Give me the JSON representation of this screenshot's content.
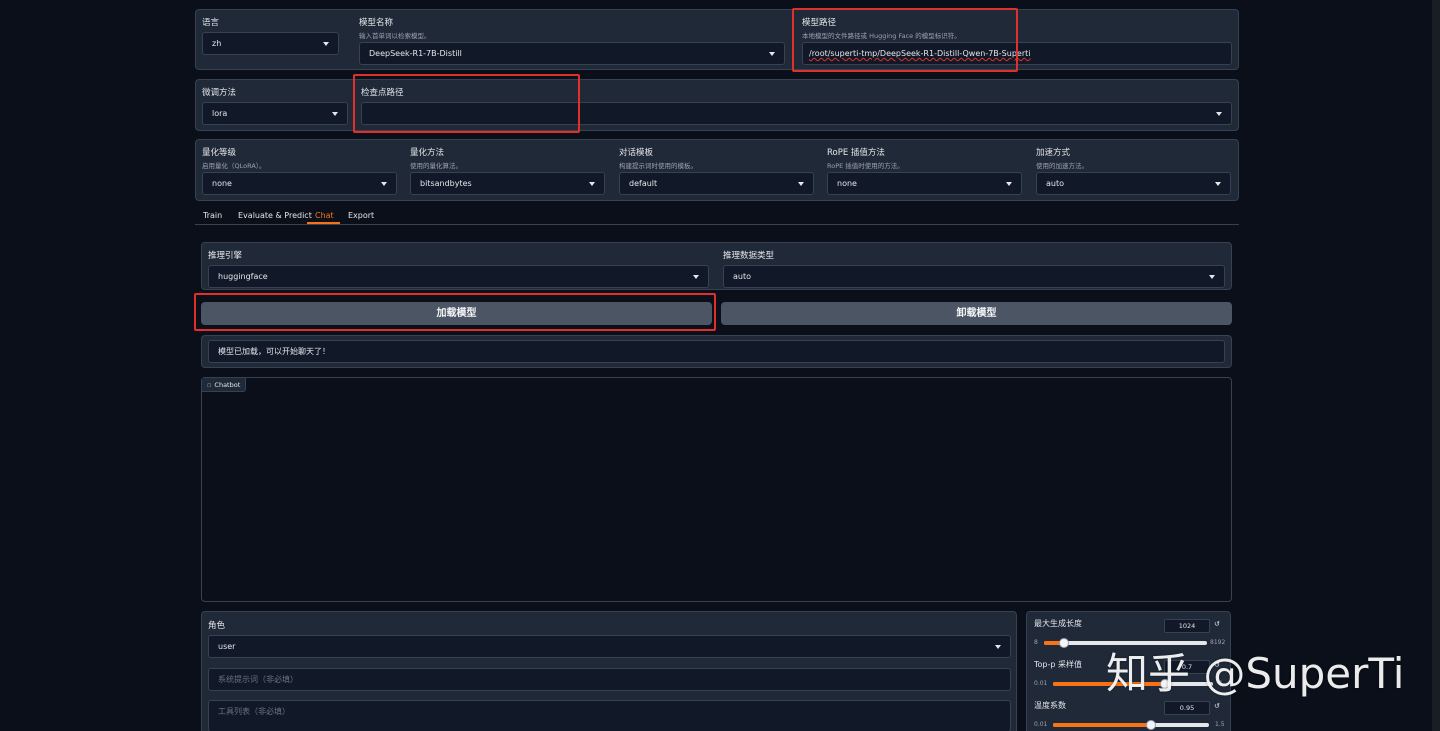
{
  "top": {
    "lang_label": "语言",
    "lang_value": "zh",
    "model_name_label": "模型名称",
    "model_name_info": "输入首单词以检索模型。",
    "model_name_value": "DeepSeek-R1-7B-Distill",
    "model_path_label": "模型路径",
    "model_path_info": "本地模型的文件路径或 Hugging Face 的模型标识符。",
    "model_path_value": "/root/superti-tmp/DeepSeek-R1-Distill-Qwen-7B-Superti"
  },
  "row2": {
    "finetune_label": "微调方法",
    "finetune_value": "lora",
    "checkpoint_label": "检查点路径",
    "checkpoint_value": ""
  },
  "row3": [
    {
      "label": "量化等级",
      "info": "启用量化（QLoRA）。",
      "value": "none"
    },
    {
      "label": "量化方法",
      "info": "使用的量化算法。",
      "value": "bitsandbytes"
    },
    {
      "label": "对话模板",
      "info": "构建提示词时使用的模板。",
      "value": "default"
    },
    {
      "label": "RoPE 插值方法",
      "info": "RoPE 插值时使用的方法。",
      "value": "none"
    },
    {
      "label": "加速方式",
      "info": "使用的加速方法。",
      "value": "auto"
    }
  ],
  "tabs": [
    "Train",
    "Evaluate & Predict",
    "Chat",
    "Export"
  ],
  "active_tab": "Chat",
  "colors": {
    "accent": "#f97316",
    "highlight": "#e0302b",
    "background": "#0b0f19",
    "panel": "#1f2937"
  },
  "chat": {
    "infer_backend_label": "推理引擎",
    "infer_backend_value": "huggingface",
    "infer_dtype_label": "推理数据类型",
    "infer_dtype_value": "auto",
    "load_button": "加载模型",
    "unload_button": "卸载模型",
    "status_text": "模型已加载，可以开始聊天了！",
    "chatbot_label": "Chatbot",
    "role_label": "角色",
    "role_value": "user",
    "system_placeholder": "系统提示词（非必填）",
    "tools_placeholder": "工具列表（非必填）"
  },
  "params": {
    "max_new_tokens": {
      "label": "最大生成长度",
      "value": "1024",
      "min": "8",
      "max": "8192",
      "fraction": 0.12
    },
    "top_p": {
      "label": "Top-p 采样值",
      "value": "0.7",
      "min": "0.01",
      "max": "1",
      "fraction": 0.7
    },
    "temperature": {
      "label": "温度系数",
      "value": "0.95",
      "min": "0.01",
      "max": "1.5",
      "fraction": 0.63
    }
  },
  "watermark": "知乎 @SuperTi"
}
